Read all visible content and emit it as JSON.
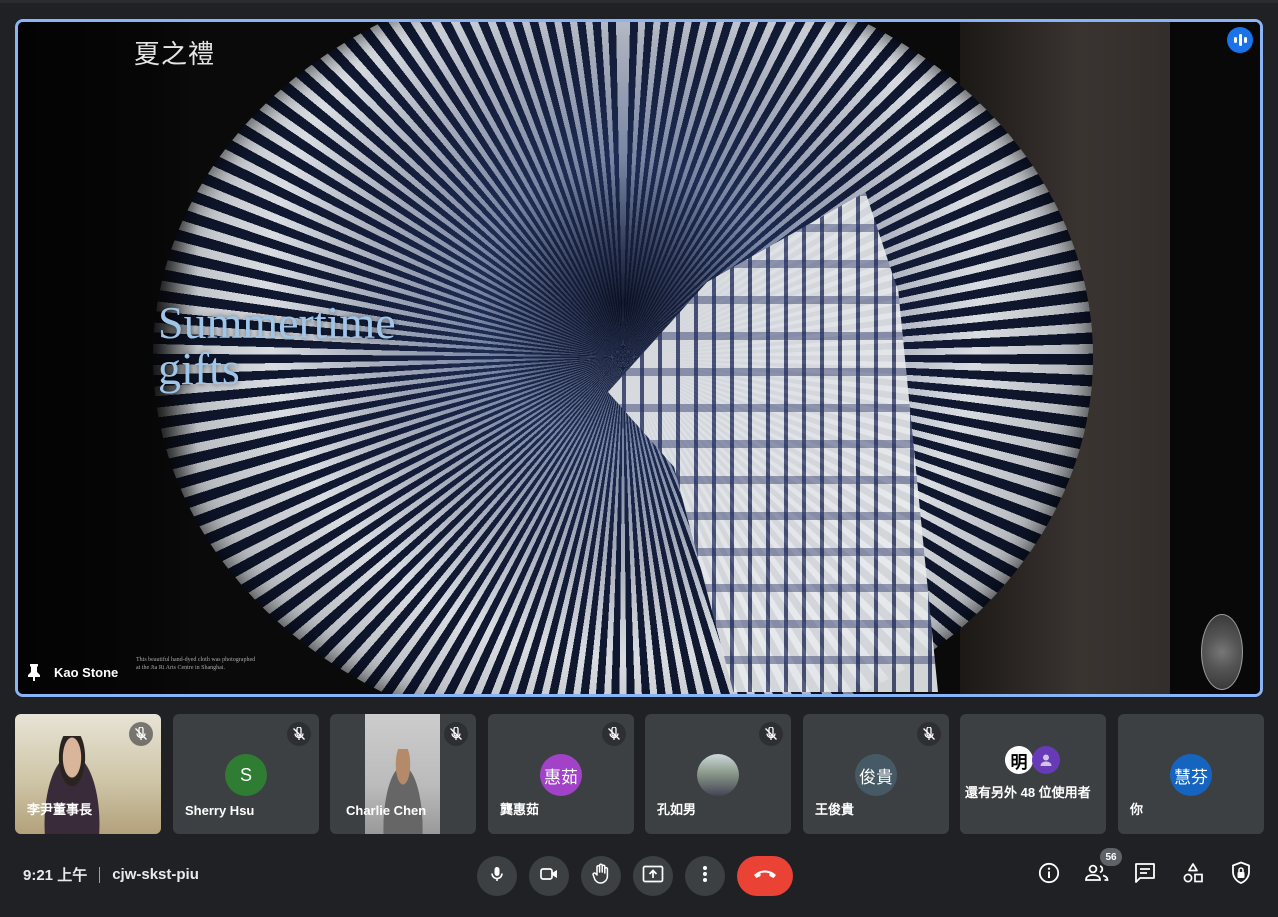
{
  "presentation": {
    "slide_title_cn": "夏之禮",
    "slide_title_en_line1": "Summertime",
    "slide_title_en_line2": "gifts",
    "caption": "This beautiful hand-dyed cloth was photographed at the Jia Ri Arts Centre in Shanghai.",
    "presenter_name": "Kao Stone"
  },
  "participants": [
    {
      "name": "李尹董事長",
      "kind": "video"
    },
    {
      "name": "Sherry Hsu",
      "initial": "S",
      "color": "#2e7d32"
    },
    {
      "name": "Charlie Chen",
      "kind": "video"
    },
    {
      "name": "龔惠茹",
      "initial": "惠茹",
      "color": "#a142c8"
    },
    {
      "name": "孔如男",
      "kind": "photo"
    },
    {
      "name": "王俊貴",
      "initial": "俊貴",
      "color": "#455a64"
    },
    {
      "name": "還有另外 48 位使用者",
      "initial": "明"
    },
    {
      "name": "你",
      "initial": "慧芬",
      "color": "#1565c0"
    }
  ],
  "bar": {
    "time": "9:21 上午",
    "meeting_code": "cjw-skst-piu",
    "people_count": "56"
  },
  "colors": {
    "accent": "#8ab4f8",
    "end_call": "#ea4335",
    "tile_bg": "#3c4043",
    "speaking": "#1a73e8"
  }
}
